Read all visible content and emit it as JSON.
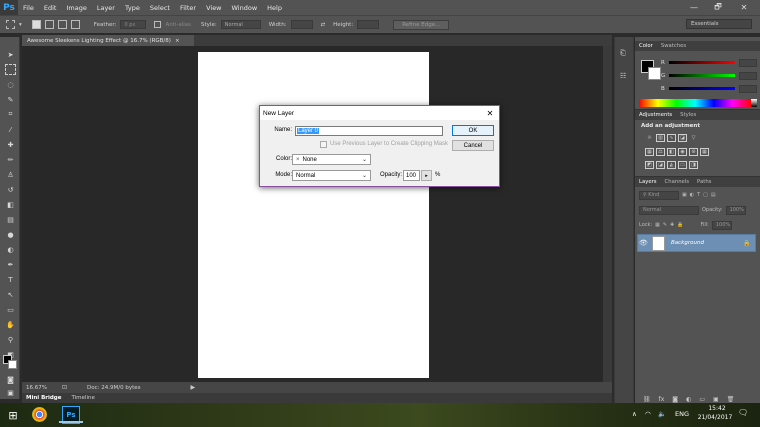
{
  "app": {
    "logo": "Ps",
    "menu": [
      "File",
      "Edit",
      "Image",
      "Layer",
      "Type",
      "Select",
      "Filter",
      "View",
      "Window",
      "Help"
    ],
    "window_controls": [
      "—",
      "🗗",
      "✕"
    ]
  },
  "options_bar": {
    "feather_label": "Feather:",
    "feather_value": "0 px",
    "antialias_label": "Anti-alias",
    "style_label": "Style:",
    "style_value": "Normal",
    "width_label": "Width:",
    "height_label": "Height:",
    "refine_edge": "Refine Edge...",
    "workspace": "Essentials"
  },
  "document": {
    "tab_title": "Awesome Sleekens Lighting Effect @ 16.7% (RGB/8)",
    "tab_close": "×"
  },
  "status": {
    "zoom": "16.67%",
    "doc_info": "Doc: 24.9M/0 bytes"
  },
  "bottom_tabs": [
    "Mini Bridge",
    "Timeline"
  ],
  "color_panel": {
    "tabs": [
      "Color",
      "Swatches"
    ],
    "fg_color": "#000000",
    "bg_color": "#ffffff",
    "channels": [
      "R",
      "G",
      "B"
    ]
  },
  "adjustments_panel": {
    "tabs": [
      "Adjustments",
      "Styles"
    ],
    "title": "Add an adjustment"
  },
  "layers_panel": {
    "tabs": [
      "Layers",
      "Channels",
      "Paths"
    ],
    "kind_label": "Kind",
    "blend_mode": "Normal",
    "opacity_label": "Opacity:",
    "opacity_value": "100%",
    "lock_label": "Lock:",
    "fill_label": "Fill:",
    "fill_value": "100%",
    "layer_name": "Background"
  },
  "dialog": {
    "title": "New Layer",
    "name_label": "Name:",
    "name_value": "Layer 0",
    "clip_label": "Use Previous Layer to Create Clipping Mask",
    "color_label": "Color:",
    "color_value": "None",
    "color_prefix": "×",
    "mode_label": "Mode:",
    "mode_value": "Normal",
    "opacity_label": "Opacity:",
    "opacity_value": "100",
    "opacity_unit": "%",
    "ok": "OK",
    "cancel": "Cancel"
  },
  "taskbar": {
    "language": "ENG",
    "time": "15:42",
    "date": "21/04/2017"
  }
}
